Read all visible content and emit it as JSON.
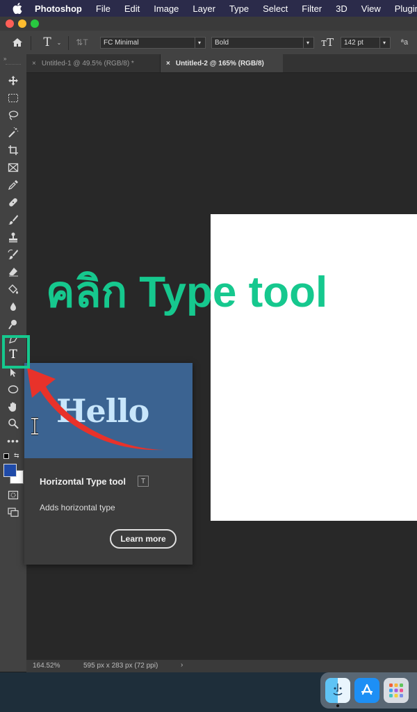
{
  "menubar": {
    "app_name": "Photoshop",
    "items": [
      "File",
      "Edit",
      "Image",
      "Layer",
      "Type",
      "Select",
      "Filter",
      "3D",
      "View",
      "Plugins"
    ]
  },
  "options_bar": {
    "tool_letter": "T",
    "font_family": "FC Minimal",
    "font_style": "Bold",
    "font_size": "142 pt",
    "antialias": "ªa"
  },
  "tabs": [
    {
      "label": "Untitled-1 @ 49.5% (RGB/8) *",
      "active": false
    },
    {
      "label": "Untitled-2 @ 165% (RGB/8)",
      "active": true
    }
  ],
  "annotation": {
    "text": "คลิก Type tool",
    "color": "#16c88e"
  },
  "tooltip": {
    "preview_text": "Hello",
    "title": "Horizontal Type tool",
    "shortcut": "T",
    "description": "Adds horizontal type",
    "button": "Learn more"
  },
  "status": {
    "zoom": "164.52%",
    "doc_info": "595 px x 283 px (72 ppi)",
    "arrow": "›"
  },
  "colors": {
    "foreground": "#1f4aa8",
    "background": "#ffffff",
    "accent": "#16c88e",
    "arrow": "#e8322a"
  },
  "tools": [
    "move-icon",
    "marquee-icon",
    "lasso-icon",
    "magic-wand-icon",
    "crop-icon",
    "frame-icon",
    "eyedropper-icon",
    "healing-icon",
    "brush-icon",
    "stamp-icon",
    "history-brush-icon",
    "eraser-icon",
    "paint-bucket-icon",
    "blur-icon",
    "dodge-icon",
    "pen-icon",
    "type-icon",
    "path-select-icon",
    "ellipse-icon",
    "hand-icon",
    "zoom-icon",
    "more-icon"
  ]
}
